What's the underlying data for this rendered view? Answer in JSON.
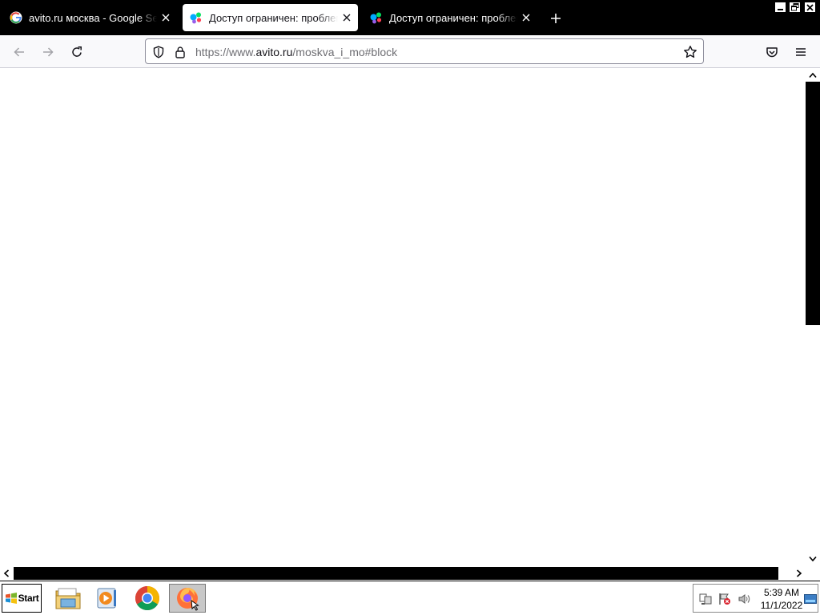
{
  "browser": {
    "tabs": [
      {
        "title": "avito.ru москва - Google Search",
        "favicon": "google-icon",
        "active": false
      },
      {
        "title": "Доступ ограничен: проблема с IP",
        "favicon": "avito-icon",
        "active": true
      },
      {
        "title": "Доступ ограничен: проблема с IP",
        "favicon": "avito-icon",
        "active": false
      }
    ],
    "url": {
      "prefix": "https://www.",
      "domain": "avito.ru",
      "path": "/moskva_i_mo#block"
    }
  },
  "taskbar": {
    "start_label": "Start",
    "apps": [
      "explorer-icon",
      "media-player-icon",
      "chrome-icon",
      "firefox-icon"
    ],
    "clock_time": "5:39 AM",
    "clock_date": "11/1/2022"
  },
  "colors": {
    "tabstrip_bg": "#000000",
    "toolbar_bg": "#f9f9fb",
    "avito_blue": "#0af",
    "avito_green": "#04e061",
    "avito_purple": "#965eeb",
    "avito_red": "#ff4053"
  }
}
